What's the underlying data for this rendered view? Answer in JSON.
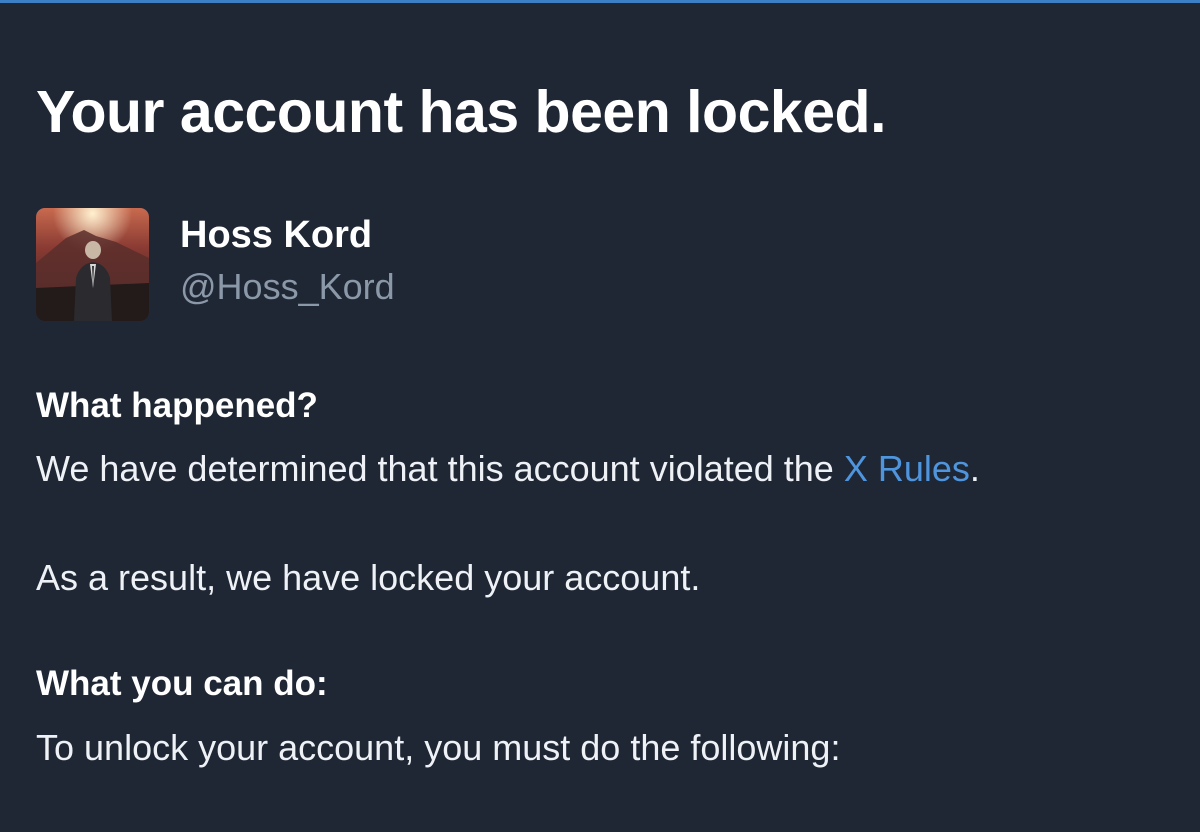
{
  "page_title": "Your account has been locked.",
  "profile": {
    "display_name": "Hoss Kord",
    "handle": "@Hoss_Kord"
  },
  "sections": {
    "what_happened": {
      "heading": "What happened?",
      "text_before_link": "We have determined that this account violated the ",
      "link_text": "X Rules",
      "text_after_link": ".",
      "result_text": "As a result, we have locked your account."
    },
    "what_you_can_do": {
      "heading": "What you can do:",
      "text": "To unlock your account, you must do the following:"
    }
  },
  "colors": {
    "background": "#1f2734",
    "link": "#4f95dd",
    "handle": "#8b98a8",
    "accent_bar": "#3d7fc4"
  }
}
